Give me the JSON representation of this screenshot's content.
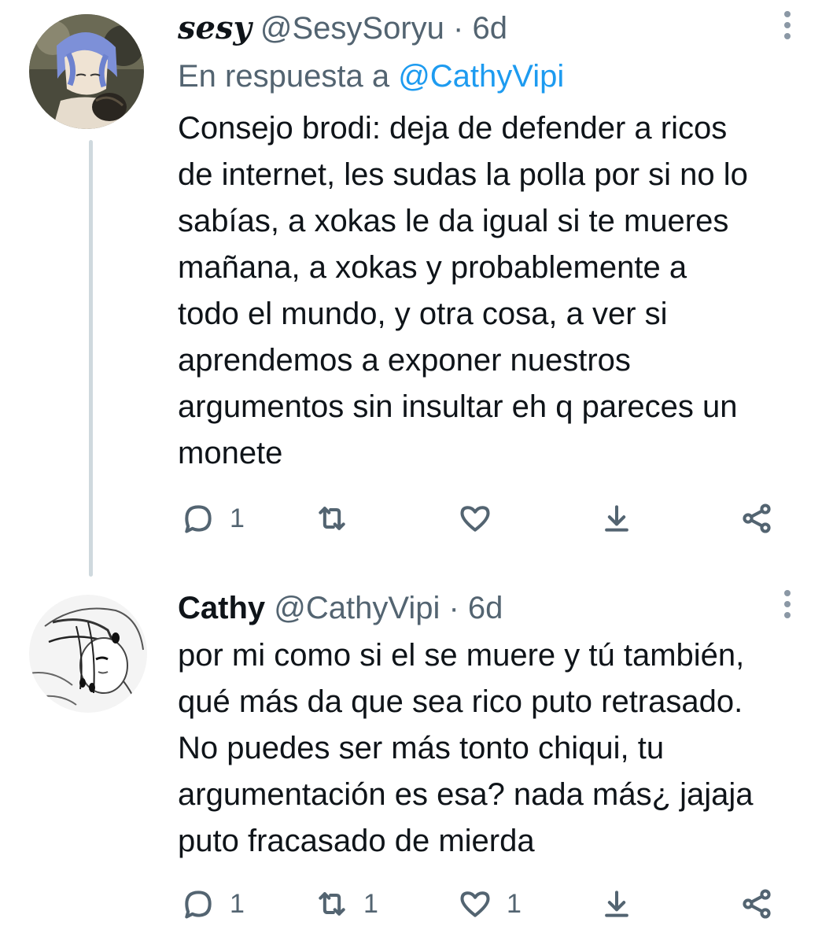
{
  "tweets": [
    {
      "display_name": "sesy",
      "handle": "@SesySoryu",
      "separator": "·",
      "time": "6d",
      "reply_prefix": "En respuesta a",
      "reply_mention": "@CathyVipi",
      "text_lines": [
        "Consejo brodi: deja de defender a ricos",
        "de internet, les sudas la polla por si no lo",
        "sabías, a xokas le da igual si te mueres",
        "mañana, a xokas y probablemente a",
        "todo el mundo, y otra cosa, a ver si",
        "aprendemos a exponer nuestros",
        "argumentos sin insultar eh q pareces un",
        "monete"
      ],
      "actions": {
        "reply_count": "1",
        "retweet_count": "",
        "like_count": "",
        "reply_icon": "comment-icon",
        "retweet_icon": "retweet-icon",
        "like_icon": "heart-icon",
        "download_icon": "download-icon",
        "share_icon": "share-icon"
      }
    },
    {
      "display_name": "Cathy",
      "handle": "@CathyVipi",
      "separator": "·",
      "time": "6d",
      "text_lines": [
        "por mi como si el se muere y tú también,",
        "qué más da que sea rico puto retrasado.",
        "No puedes ser más tonto chiqui, tu",
        "argumentación es esa? nada más¿ jajaja",
        "puto fracasado de mierda"
      ],
      "actions": {
        "reply_count": "1",
        "retweet_count": "1",
        "like_count": "1",
        "reply_icon": "comment-icon",
        "retweet_icon": "retweet-icon",
        "like_icon": "heart-icon",
        "download_icon": "download-icon",
        "share_icon": "share-icon"
      }
    }
  ],
  "colors": {
    "text": "#0f1419",
    "secondary": "#536471",
    "link": "#1d9bf0",
    "thread_line": "#cfd9de"
  }
}
